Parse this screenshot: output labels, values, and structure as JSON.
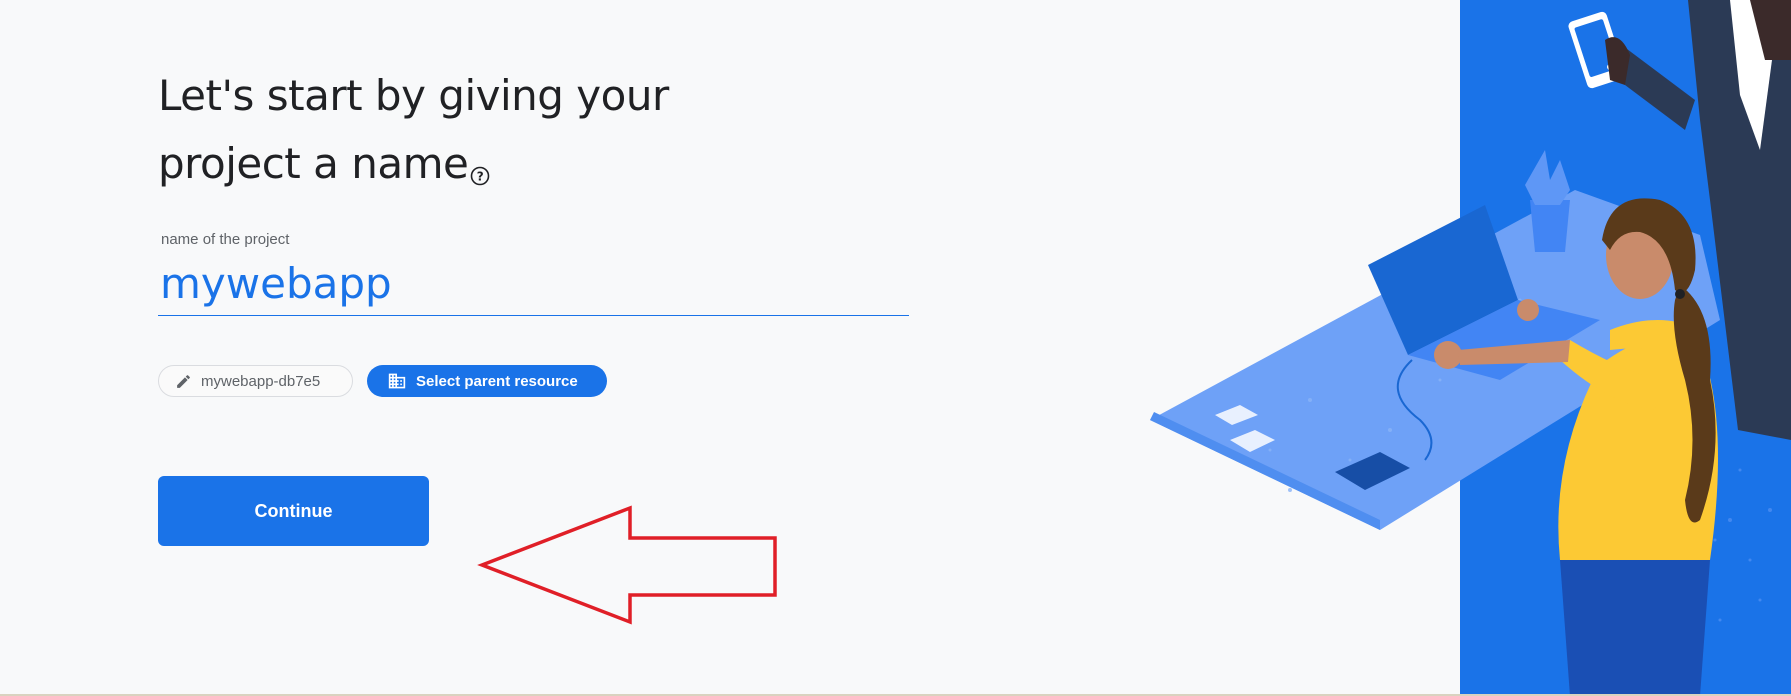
{
  "headline": {
    "line1": "Let's start by giving your",
    "line2": "project a name"
  },
  "name_field": {
    "label": "name of the project",
    "value": "mywebapp"
  },
  "project_id_chip": {
    "label": "mywebapp-db7e5"
  },
  "parent_resource_chip": {
    "label": "Select parent resource"
  },
  "continue_button": {
    "label": "Continue"
  },
  "colors": {
    "accent": "#1a73e8",
    "annotation_arrow": "#e01f27",
    "illustration_yellow": "#fcc934",
    "background": "#f8f9fa"
  },
  "icons": [
    "help-circle-icon",
    "pencil-icon",
    "building-icon"
  ]
}
